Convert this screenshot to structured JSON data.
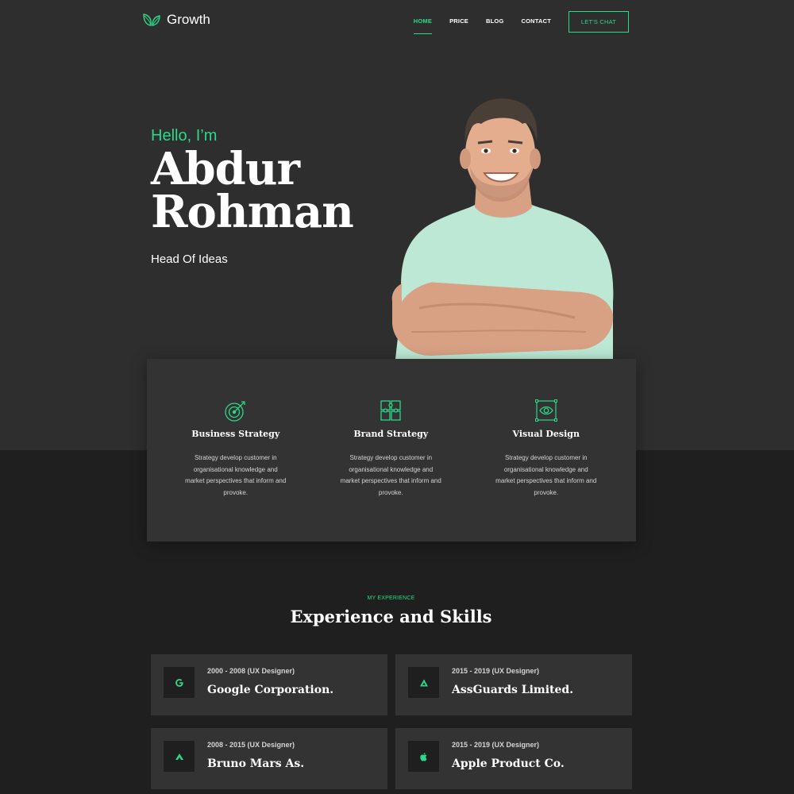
{
  "brand": {
    "name": "Growth",
    "accent_color": "#2bd98a",
    "icon": "leaf-icon"
  },
  "nav": {
    "items": [
      {
        "label": "HOME",
        "active": true
      },
      {
        "label": "PRICE",
        "active": false
      },
      {
        "label": "BLOG",
        "active": false
      },
      {
        "label": "CONTACT",
        "active": false
      }
    ],
    "cta_label": "LET'S CHAT"
  },
  "hero": {
    "greeting": "Hello, I’m",
    "name_line1": "Abdur",
    "name_line2": "Rohman",
    "role": "Head Of Ideas",
    "portrait": "smiling-man-portrait"
  },
  "services": [
    {
      "icon": "target-icon",
      "title": "Business Strategy",
      "text": "Strategy develop customer in organisational knowledge and market perspectives that inform and provoke."
    },
    {
      "icon": "puzzle-icon",
      "title": "Brand Strategy",
      "text": "Strategy develop customer in organisational knowledge and market perspectives that inform and provoke."
    },
    {
      "icon": "eye-frame-icon",
      "title": "Visual Design",
      "text": "Strategy develop customer in organisational knowledge and market perspectives that inform and provoke."
    }
  ],
  "experience": {
    "eyebrow": "MY EXPERIENCE",
    "heading": "Experience and Skills",
    "items": [
      {
        "period": "2000 - 2008 (UX Designer)",
        "company": "Google Corporation.",
        "icon": "google-icon"
      },
      {
        "period": "2015 - 2019 (UX Designer)",
        "company": "AssGuards Limited.",
        "icon": "triangle-logo-icon"
      },
      {
        "period": "2008 - 2015 (UX Designer)",
        "company": "Bruno Mars As.",
        "icon": "arrow-logo-icon"
      },
      {
        "period": "2015 - 2019 (UX Designer)",
        "company": "Apple Product Co.",
        "icon": "apple-icon"
      }
    ]
  }
}
